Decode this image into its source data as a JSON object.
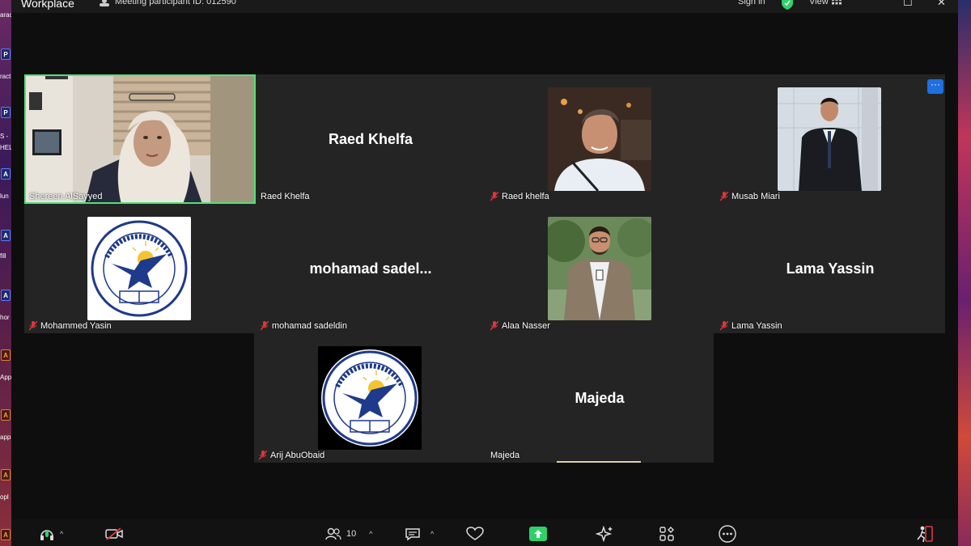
{
  "window": {
    "app_title": "Workplace",
    "meeting_id_text": "Meeting participant ID: 012590",
    "sign_in_label": "Sign in",
    "view_label": "View"
  },
  "desktop": {
    "labels": [
      "arac",
      "ract",
      "S -",
      "HEL",
      "lun",
      "fill",
      "hor",
      "App",
      "app",
      "opl"
    ]
  },
  "participants": [
    {
      "id": "shereen",
      "label": "Shereen AlSayyed",
      "display_name": "",
      "muted": false,
      "video": true,
      "active_speaker": true
    },
    {
      "id": "raed1",
      "label": "Raed Khelfa",
      "display_name": "Raed Khelfa",
      "muted": false,
      "video": false
    },
    {
      "id": "raed2",
      "label": "Raed khelfa",
      "display_name": "",
      "muted": true,
      "video": true
    },
    {
      "id": "musab",
      "label": "Musab Miari",
      "display_name": "",
      "muted": true,
      "video": true
    },
    {
      "id": "mohammed",
      "label": "Mohammed Yasin",
      "display_name": "",
      "muted": true,
      "video": true
    },
    {
      "id": "sadeldin",
      "label": "mohamad sadeldin",
      "display_name": "mohamad  sadel...",
      "muted": true,
      "video": false
    },
    {
      "id": "alaa",
      "label": "Alaa Nasser",
      "display_name": "",
      "muted": true,
      "video": true
    },
    {
      "id": "lama",
      "label": "Lama Yassin",
      "display_name": "Lama Yassin",
      "muted": true,
      "video": false
    },
    {
      "id": "arij",
      "label": "Arij AbuObaid",
      "display_name": "",
      "muted": true,
      "video": true
    },
    {
      "id": "majeda",
      "label": "Majeda",
      "display_name": "Majeda",
      "muted": false,
      "video": false
    }
  ],
  "toolbar": {
    "participants_count": "10"
  },
  "colors": {
    "active_speaker": "#4ee27a",
    "muted_red": "#e0363a",
    "share_green": "#2fd06a",
    "more_blue": "#1f6fe0"
  },
  "icons": [
    "microphone-icon",
    "video-off-icon",
    "participants-icon",
    "chat-icon",
    "reactions-icon",
    "share-screen-icon",
    "ai-companion-icon",
    "apps-icon",
    "more-icon",
    "leave-icon"
  ]
}
